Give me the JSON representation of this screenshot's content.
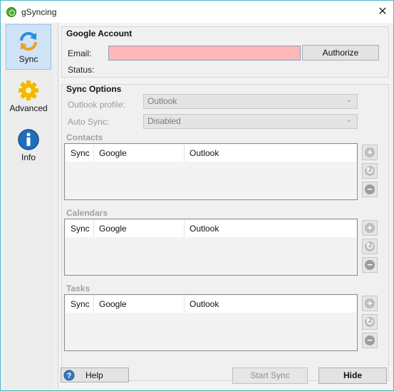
{
  "window": {
    "title": "gSyncing",
    "close_glyph": "✕"
  },
  "sidebar": {
    "items": [
      {
        "label": "Sync",
        "icon": "sync-icon",
        "selected": true
      },
      {
        "label": "Advanced",
        "icon": "gear-icon",
        "selected": false
      },
      {
        "label": "Info",
        "icon": "info-icon",
        "selected": false
      }
    ]
  },
  "account": {
    "title": "Google Account",
    "email_label": "Email:",
    "email_value": "",
    "status_label": "Status:",
    "authorize_label": "Authorize"
  },
  "options": {
    "title": "Sync Options",
    "profile_label": "Outlook profile:",
    "profile_value": "Outlook",
    "auto_sync_label": "Auto Sync:",
    "auto_sync_value": "Disabled"
  },
  "sections": [
    {
      "label": "Contacts",
      "columns": [
        "Sync",
        "Google",
        "Outlook"
      ]
    },
    {
      "label": "Calendars",
      "columns": [
        "Sync",
        "Google",
        "Outlook"
      ]
    },
    {
      "label": "Tasks",
      "columns": [
        "Sync",
        "Google",
        "Outlook"
      ]
    }
  ],
  "footer": {
    "help_label": "Help",
    "start_sync_label": "Start Sync",
    "hide_label": "Hide"
  },
  "colors": {
    "email_invalid_bg": "#ffb7b8",
    "selected_nav_bg": "#cfe3f7",
    "window_border": "#48b8c8"
  }
}
